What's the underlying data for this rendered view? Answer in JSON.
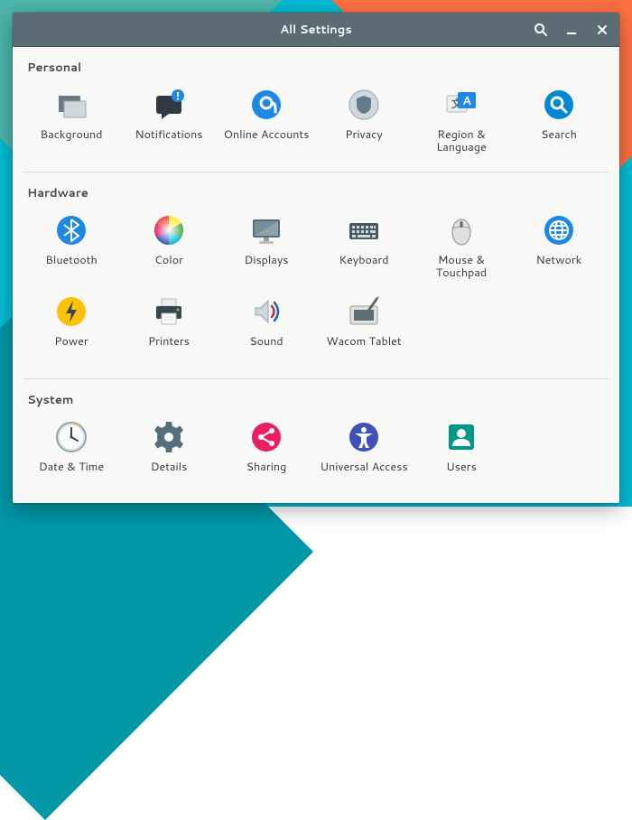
{
  "window": {
    "title": "All Settings"
  },
  "sections": {
    "personal": {
      "title": "Personal",
      "items": [
        {
          "label": "Background"
        },
        {
          "label": "Notifications"
        },
        {
          "label": "Online Accounts"
        },
        {
          "label": "Privacy"
        },
        {
          "label": "Region & Language"
        },
        {
          "label": "Search"
        }
      ]
    },
    "hardware": {
      "title": "Hardware",
      "items": [
        {
          "label": "Bluetooth"
        },
        {
          "label": "Color"
        },
        {
          "label": "Displays"
        },
        {
          "label": "Keyboard"
        },
        {
          "label": "Mouse & Touchpad"
        },
        {
          "label": "Network"
        },
        {
          "label": "Power"
        },
        {
          "label": "Printers"
        },
        {
          "label": "Sound"
        },
        {
          "label": "Wacom Tablet"
        }
      ]
    },
    "system": {
      "title": "System",
      "items": [
        {
          "label": "Date & Time"
        },
        {
          "label": "Details"
        },
        {
          "label": "Sharing"
        },
        {
          "label": "Universal Access"
        },
        {
          "label": "Users"
        }
      ]
    }
  }
}
